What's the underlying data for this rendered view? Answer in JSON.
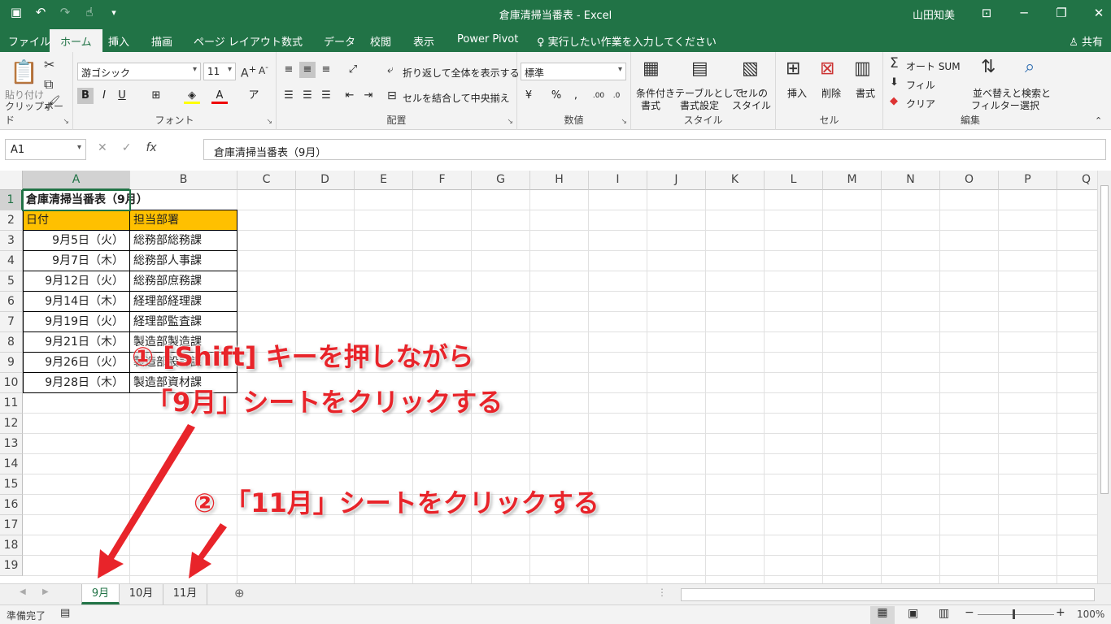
{
  "window": {
    "title": "倉庫清掃当番表 - Excel",
    "user": "山田知美",
    "controls": [
      "⊡",
      "─",
      "❐",
      "✕"
    ]
  },
  "menu": {
    "tabs": [
      "ファイル",
      "ホーム",
      "挿入",
      "描画",
      "ページ レイアウト",
      "数式",
      "データ",
      "校閲",
      "表示",
      "Power Pivot",
      "♀ 実行したい作業を入力してください"
    ],
    "active": "ホーム",
    "share": "共有"
  },
  "ribbon": {
    "clipboard": {
      "label": "クリップボード",
      "paste": "貼り付け"
    },
    "font": {
      "label": "フォント",
      "name": "游ゴシック",
      "size": "11"
    },
    "alignment": {
      "label": "配置",
      "wrap": "折り返して全体を表示する",
      "merge": "セルを結合して中央揃え"
    },
    "number": {
      "label": "数値",
      "format": "標準"
    },
    "styles": {
      "label": "スタイル",
      "conditional": [
        "条件付き",
        "書式"
      ],
      "table": [
        "テーブルとして",
        "書式設定"
      ],
      "cell": [
        "セルの",
        "スタイル"
      ]
    },
    "cells": {
      "label": "セル",
      "insert": "挿入",
      "delete": "削除",
      "format": "書式"
    },
    "editing": {
      "label": "編集",
      "autosum": "オート SUM",
      "fill": "フィル",
      "clear": "クリア",
      "sort": [
        "並べ替えと",
        "フィルター"
      ],
      "find": [
        "検索と",
        "選択"
      ]
    }
  },
  "formula_bar": {
    "name_box": "A1",
    "content": "倉庫清掃当番表（9月）"
  },
  "grid": {
    "columns": [
      "A",
      "B",
      "C",
      "D",
      "E",
      "F",
      "G",
      "H",
      "I",
      "J",
      "K",
      "L",
      "M",
      "N",
      "O",
      "P",
      "Q"
    ],
    "rows": [
      "1",
      "2",
      "3",
      "4",
      "5",
      "6",
      "7",
      "8",
      "9",
      "10",
      "11",
      "12",
      "13",
      "14",
      "15",
      "16",
      "17",
      "18",
      "19"
    ],
    "title": "倉庫清掃当番表（9月）",
    "headers": [
      "日付",
      "担当部署"
    ],
    "data": [
      [
        "9月5日（火）",
        "総務部総務課"
      ],
      [
        "9月7日（木）",
        "総務部人事課"
      ],
      [
        "9月12日（火）",
        "総務部庶務課"
      ],
      [
        "9月14日（木）",
        "経理部経理課"
      ],
      [
        "9月19日（火）",
        "経理部監査課"
      ],
      [
        "9月21日（木）",
        "製造部製造課"
      ],
      [
        "9月26日（火）",
        "製造部設計課"
      ],
      [
        "9月28日（木）",
        "製造部資材課"
      ]
    ]
  },
  "sheets": {
    "tabs": [
      "9月",
      "10月",
      "11月"
    ],
    "active": "9月"
  },
  "status": {
    "ready": "準備完了",
    "zoom": "100%"
  },
  "annotations": {
    "step1_line1": "① [Shift] キーを押しながら",
    "step1_line2": "「9月」シートをクリックする",
    "step2": "② 「11月」シートをクリックする"
  },
  "colors": {
    "excel_green": "#217346",
    "header_fill": "#ffc000",
    "annotation_red": "#e8242a"
  }
}
